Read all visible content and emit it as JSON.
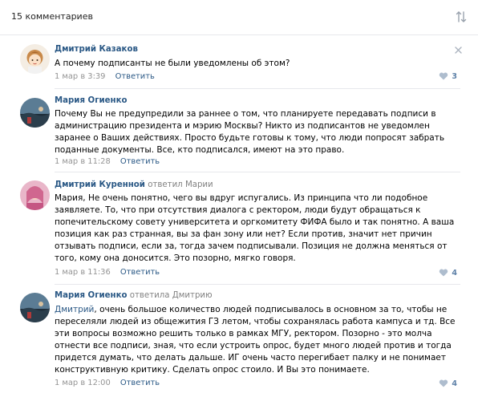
{
  "header": {
    "title": "15 комментариев"
  },
  "comments": [
    {
      "author": "Дмитрий Казаков",
      "reply_prefix": "",
      "reply_target": "",
      "text": "А почему подписанты не были уведомлены об этом?",
      "mention": "",
      "date": "1 мар в 3:39",
      "reply_label": "Ответить",
      "likes": "3",
      "avatar": "cartoon-girl-avatar"
    },
    {
      "author": "Мария Огиенко",
      "reply_prefix": "",
      "reply_target": "",
      "text": "Почему Вы не предупредили за раннее о том, что планируете передавать подписи в\nадминистрацию президента и мэрию Москвы? Никто из подписантов не уведомлен\nзаранее о Ваших действиях. Просто будьте готовы к тому, что люди попросят забрать\nподанные документы. Все, кто подписался, имеют на это право.",
      "mention": "",
      "date": "1 мар в 11:28",
      "reply_label": "Ответить",
      "likes": "",
      "avatar": "sunset-photo-avatar"
    },
    {
      "author": "Дмитрий Куренной",
      "reply_prefix": " ответил ",
      "reply_target": "Марии",
      "text": "Мария, Не очень понятно, чего вы вдруг испугались. Из принципа что ли подобное\nзаявляете. То, что при отсутствия диалога с ректором, люди будут обращаться к\nпопечительскому совету университета и оргкомитету ФИФА было и так понятно. А ваша\nпозиция как раз странная, вы за фан зону или нет? Если против, значит нет причин\nотзывать подписи, если за, тогда зачем подписывали. Позиция не должна меняться от\nтого, кому она доносится. Это позорно, мягко говоря.",
      "mention": "",
      "date": "1 мар в 11:36",
      "reply_label": "Ответить",
      "likes": "4",
      "avatar": "pink-portrait-avatar"
    },
    {
      "author": "Мария Огиенко",
      "reply_prefix": " ответила ",
      "reply_target": "Дмитрию",
      "mention": "Дмитрий",
      "text": ", очень большое количество людей подписывалось в основном за то, чтобы не\nпереселяли людей из общежития ГЗ летом, чтобы сохранялась работа кампуса и тд. Все\nэти вопросы возможно решить только в рамках МГУ, ректором. Позорно - это молча\nотнести все подписи, зная, что если устроить опрос, будет много людей против и тогда\nпридется думать, что делать дальше. ИГ очень часто перегибает палку и не понимает\nконструктивную критику. Сделать опрос стоило. И Вы это понимаете.",
      "date": "1 мар в 12:00",
      "reply_label": "Ответить",
      "likes": "4",
      "avatar": "sunset-photo-avatar"
    }
  ],
  "colors": {
    "link": "#2a5885",
    "muted": "#939393",
    "divider": "#e7e8ec",
    "like": "#5e81a8"
  }
}
